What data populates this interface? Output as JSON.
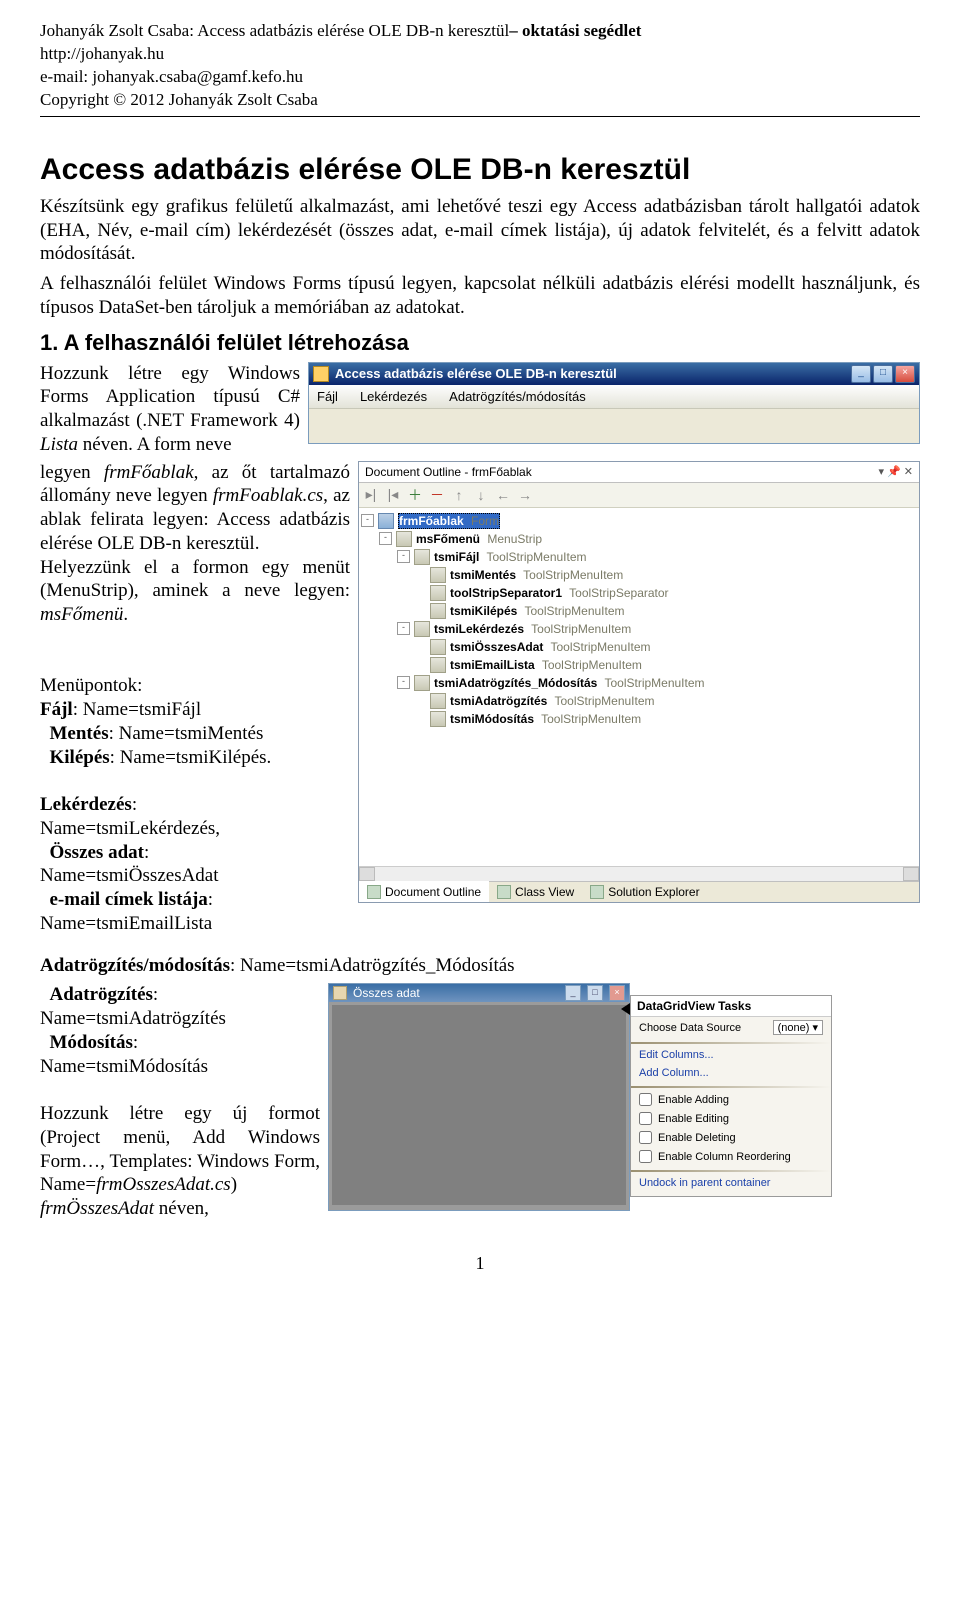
{
  "header": {
    "author_title": "Johanyák Zsolt Csaba: Access adatbázis elérése OLE DB-n keresztül",
    "suffix": "– oktatási segédlet",
    "url": "http://johanyak.hu",
    "email_line": "e-mail: johanyak.csaba@gamf.kefo.hu",
    "copyright": "Copyright © 2012 Johanyák Zsolt Csaba"
  },
  "title": "Access adatbázis elérése OLE DB-n keresztül",
  "intro": "Készítsünk egy grafikus felületű alkalmazást, ami lehetővé teszi egy Access adatbázisban tárolt hallgatói adatok (EHA, Név, e-mail cím) lekérdezését (összes adat, e-mail címek listája), új adatok felvitelét, és a felvitt adatok módosítását.",
  "intro2": "A felhasználói felület Windows Forms típusú legyen, kapcsolat nélküli adatbázis elérési modellt használjunk, és típusos DataSet-ben tároljuk a memóriában az adatokat.",
  "section1": "1. A felhasználói felület létrehozása",
  "left1": "Hozzunk létre egy Windows Forms Application típusú C# alkalmazást (.NET Framework 4) ",
  "left1b": "Lista",
  "left1c": " néven. A form neve",
  "left2a": "legyen ",
  "left2b": "frmFőablak",
  "left2c": ", az őt tartalmazó állomány neve legyen ",
  "left2d": "frmFoablak.cs",
  "left2e": ", az ablak felirata legyen: Access adatbázis elérése OLE DB-n keresztül.",
  "left3": "Helyezzünk el a formon egy menüt (MenuStrip), aminek a neve legyen: ",
  "left3b": "msFőmenü",
  "left3c": ".",
  "menu_pts_title": "Menüpontok:",
  "menu_pts": {
    "fajl": "Fájl",
    "fajl_name": ": Name=tsmiFájl",
    "mentes": "Mentés",
    "mentes_name": ": Name=tsmiMentés",
    "kilepes": "Kilépés",
    "kilepes_name": ": Name=tsmiKilépés."
  },
  "lekerdezes_block": {
    "t1": "Lekérdezés",
    "l1": "Name=tsmiLekérdezés,",
    "t2": "Összes adat",
    "l2": "Name=tsmiÖsszesAdat",
    "t3": "e-mail címek listája",
    "l3": "Name=tsmiEmailLista"
  },
  "adatr_line": {
    "bold": "Adatrögzítés/módosítás",
    "rest": ": Name=tsmiAdatrögzítés_Módosítás"
  },
  "adatr_block": {
    "t1": "Adatrögzítés",
    "l1": "Name=tsmiAdatrögzítés",
    "t2": "Módosítás",
    "l2": "Name=tsmiMódosítás"
  },
  "form2_text": {
    "p1": "Hozzunk létre egy új formot (Project menü, Add Windows Form…, Templates: Windows Form, Name=",
    "p2": "frmOsszesAdat.cs",
    "p3": ") ",
    "p4": "frmÖsszesAdat",
    "p5": " néven,"
  },
  "winform": {
    "title": "Access adatbázis elérése OLE DB-n keresztül",
    "menu": [
      "Fájl",
      "Lekérdezés",
      "Adatrögzítés/módosítás"
    ]
  },
  "outline": {
    "title": "Document Outline - frmFőablak",
    "tree": [
      {
        "depth": 0,
        "exp": "-",
        "icon": "form",
        "name": "frmFőablak",
        "type": "Form",
        "sel": true
      },
      {
        "depth": 1,
        "exp": "-",
        "icon": "item",
        "name": "msFőmenü",
        "type": "MenuStrip"
      },
      {
        "depth": 2,
        "exp": "-",
        "icon": "item",
        "name": "tsmiFájl",
        "type": "ToolStripMenuItem"
      },
      {
        "depth": 3,
        "exp": "",
        "icon": "item",
        "name": "tsmiMentés",
        "type": "ToolStripMenuItem"
      },
      {
        "depth": 3,
        "exp": "",
        "icon": "item",
        "name": "toolStripSeparator1",
        "type": "ToolStripSeparator"
      },
      {
        "depth": 3,
        "exp": "",
        "icon": "item",
        "name": "tsmiKilépés",
        "type": "ToolStripMenuItem"
      },
      {
        "depth": 2,
        "exp": "-",
        "icon": "item",
        "name": "tsmiLekérdezés",
        "type": "ToolStripMenuItem"
      },
      {
        "depth": 3,
        "exp": "",
        "icon": "item",
        "name": "tsmiÖsszesAdat",
        "type": "ToolStripMenuItem"
      },
      {
        "depth": 3,
        "exp": "",
        "icon": "item",
        "name": "tsmiEmailLista",
        "type": "ToolStripMenuItem"
      },
      {
        "depth": 2,
        "exp": "-",
        "icon": "item",
        "name": "tsmiAdatrögzítés_Módosítás",
        "type": "ToolStripMenuItem"
      },
      {
        "depth": 3,
        "exp": "",
        "icon": "item",
        "name": "tsmiAdatrögzítés",
        "type": "ToolStripMenuItem"
      },
      {
        "depth": 3,
        "exp": "",
        "icon": "item",
        "name": "tsmiMódosítás",
        "type": "ToolStripMenuItem"
      }
    ],
    "tabs": [
      "Document Outline",
      "Class View",
      "Solution Explorer"
    ]
  },
  "form2": {
    "title": "Összes adat",
    "tasks_title": "DataGridView Tasks",
    "ds_label": "Choose Data Source",
    "ds_value": "(none)",
    "links": [
      "Edit Columns...",
      "Add Column..."
    ],
    "checks": [
      "Enable Adding",
      "Enable Editing",
      "Enable Deleting",
      "Enable Column Reordering"
    ],
    "undock": "Undock in parent container"
  },
  "page_number": "1"
}
